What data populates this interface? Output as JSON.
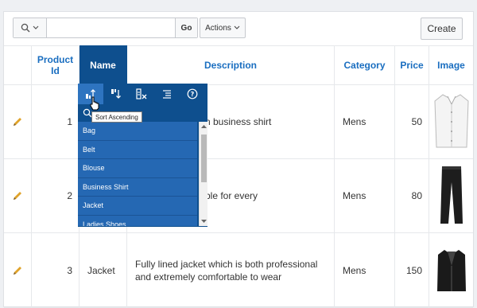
{
  "toolbar": {
    "search_icon": "search-icon",
    "search_value": "",
    "go_label": "Go",
    "actions_label": "Actions",
    "create_label": "Create"
  },
  "columns": [
    "Product Id",
    "Name",
    "Description",
    "Category",
    "Price",
    "Image"
  ],
  "rows": [
    {
      "id": "1",
      "name": "",
      "description": "Wrinkle free business shirt",
      "description_visible": "n business shirt",
      "category": "Mens",
      "price": "50",
      "image": "shirt"
    },
    {
      "id": "2",
      "name": "",
      "description_visible": "ble for every",
      "category": "Mens",
      "price": "80",
      "image": "trousers"
    },
    {
      "id": "3",
      "name": "Jacket",
      "description": "Fully lined jacket which is both professional and extremely comfortable to wear",
      "category": "Mens",
      "price": "150",
      "image": "jacket"
    }
  ],
  "header_menu": {
    "icons": [
      "sort-ascending-icon",
      "sort-descending-icon",
      "hide-column-icon",
      "control-break-icon",
      "help-icon"
    ],
    "tooltip": "Sort Ascending",
    "items": [
      "Bag",
      "Belt",
      "Blouse",
      "Business Shirt",
      "Jacket",
      "Ladies Shoes"
    ]
  },
  "colors": {
    "header_text": "#1a6ec0",
    "active_header": "#0e4f8e",
    "menu_list": "#2568b3",
    "edit_icon": "#e0a32a"
  }
}
